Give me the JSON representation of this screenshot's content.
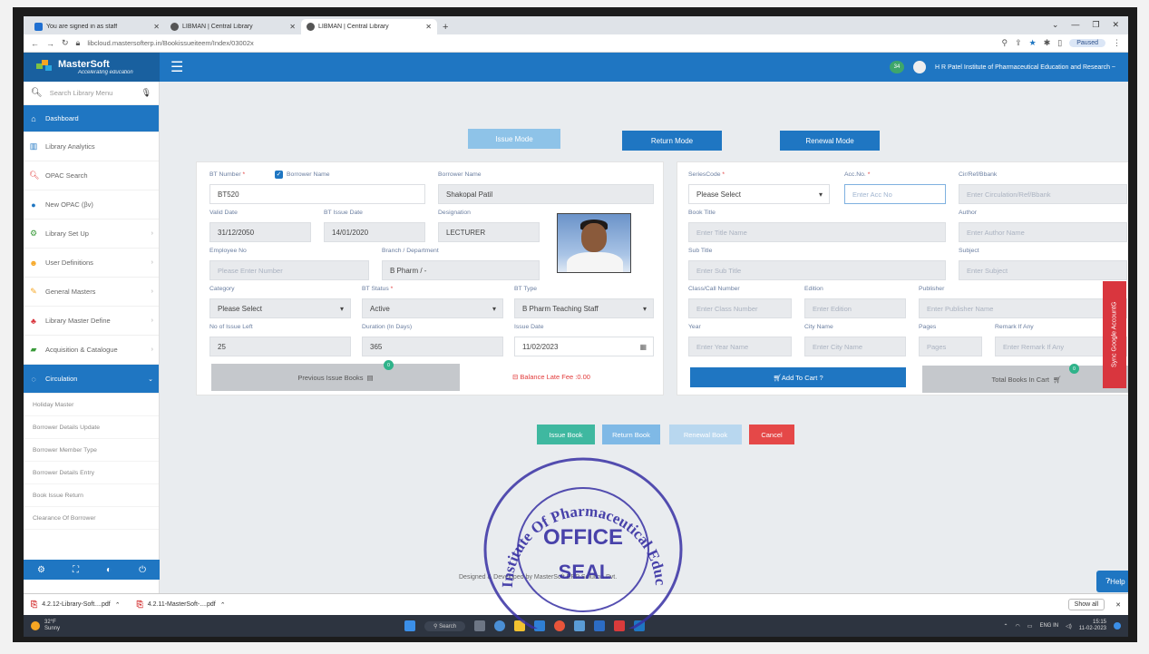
{
  "browser": {
    "tabs": [
      {
        "title": "You are signed in as staff"
      },
      {
        "title": "LIBMAN | Central Library"
      },
      {
        "title": "LIBMAN | Central Library"
      }
    ],
    "new_tab": "+",
    "url": "libcloud.mastersofterp.in/Bookissueiteem/Index/03002x",
    "profile": "Paused"
  },
  "header": {
    "logo": "MasterSoft",
    "tagline": "Accelerating education",
    "menu_icon": "hamburger-icon",
    "notif_count": "34",
    "institute": "H R Patel Institute of Pharmaceutical Education and Research ~"
  },
  "sidebar": {
    "search_placeholder": "Search Library Menu",
    "items": [
      {
        "label": "Dashboard",
        "icon": "home-icon"
      },
      {
        "label": "Library Analytics",
        "icon": "chart-icon"
      },
      {
        "label": "OPAC Search",
        "icon": "search-icon"
      },
      {
        "label": "New OPAC (βv)",
        "icon": "globe-icon"
      },
      {
        "label": "Library Set Up",
        "icon": "gears-icon"
      },
      {
        "label": "User Definitions",
        "icon": "users-icon"
      },
      {
        "label": "General Masters",
        "icon": "edit-icon"
      },
      {
        "label": "Library Master Define",
        "icon": "sitemap-icon"
      },
      {
        "label": "Acquisition & Catalogue",
        "icon": "book-icon"
      },
      {
        "label": "Circulation",
        "icon": "circle-icon"
      }
    ],
    "subitems": [
      "Holiday Master",
      "Borrower Details Update",
      "Borrower Member Type",
      "Borrower Details Entry",
      "Book Issue Return",
      "Clearance Of Borrower"
    ]
  },
  "modes": {
    "issue": "Issue Mode",
    "return": "Return Mode",
    "renewal": "Renewal Mode"
  },
  "borrower": {
    "bt_number_label": "BT Number",
    "borrower_name_check": "Borrower Name",
    "bt_number": "BT520",
    "borrower_name_label": "Borrower Name",
    "borrower_name": "Shakopal  Patil",
    "valid_date_label": "Valid Date",
    "valid_date": "31/12/2050",
    "bt_issue_date_label": "BT Issue Date",
    "bt_issue_date": "14/01/2020",
    "designation_label": "Designation",
    "designation": "LECTURER",
    "employee_no_label": "Employee No",
    "employee_no_placeholder": "Please Enter Number",
    "branch_label": "Branch / Department",
    "branch": "B Pharm / -",
    "category_label": "Category",
    "category": "Please Select",
    "bt_status_label": "BT Status",
    "bt_status": "Active",
    "bt_type_label": "BT Type",
    "bt_type": "B Pharm Teaching Staff",
    "issue_left_label": "No of Issue Left",
    "issue_left": "25",
    "duration_label": "Duration (In Days)",
    "duration": "365",
    "issue_date_label": "Issue Date",
    "issue_date": "11/02/2023",
    "previous_issue_books": "Previous Issue Books",
    "previous_badge": "0",
    "late_fee": "Balance Late Fee :0.00"
  },
  "book": {
    "series_label": "SeriesCode",
    "series": "Please Select",
    "acc_label": "Acc.No.",
    "acc_placeholder": "Enter Acc No",
    "cir_label": "Cir/Ref/Bbank",
    "cir_placeholder": "Enter Circulation/Ref/Bbank",
    "title_label": "Book Title",
    "title_placeholder": "Enter Title Name",
    "author_label": "Author",
    "author_placeholder": "Enter Author Name",
    "subtitle_label": "Sub Title",
    "subtitle_placeholder": "Enter Sub Title",
    "subject_label": "Subject",
    "subject_placeholder": "Enter Subject",
    "class_label": "Class/Call Number",
    "class_placeholder": "Enter Class Number",
    "edition_label": "Edition",
    "edition_placeholder": "Enter Edition",
    "publisher_label": "Publisher",
    "publisher_placeholder": "Enter Publisher Name",
    "year_label": "Year",
    "year_placeholder": "Enter Year Name",
    "city_label": "City Name",
    "city_placeholder": "Enter City Name",
    "pages_label": "Pages",
    "pages_placeholder": "Pages",
    "remark_label": "Remark If Any",
    "remark_placeholder": "Enter Remark If Any",
    "add_to_cart": "Add To Cart ?",
    "total_books": "Total Books In Cart",
    "cart_badge": "0"
  },
  "actions": {
    "issue": "Issue Book",
    "return": "Return Book",
    "renewal": "Renewal Book",
    "cancel": "Cancel"
  },
  "footer": {
    "text": "Designed & Developed by MasterSoft ERP Solution Pvt.",
    "help": "Help",
    "sync": "Sync Google Account"
  },
  "downloads": [
    "4.2.12-Library-Soft....pdf",
    "4.2.11-MasterSoft-....pdf"
  ],
  "downloads_show_all": "Show all",
  "taskbar": {
    "weather_temp": "32°F",
    "weather_text": "Sunny",
    "search": "Search",
    "lang": "ENG IN",
    "time": "15:15",
    "date": "11-02-2023"
  },
  "seal": {
    "ring_text": "Institute Of Pharmaceutical Education & Research",
    "line1": "OFFICE",
    "line2": "SEAL"
  },
  "colors": {
    "primary": "#1f76c2",
    "issue_mode": "#8ec3e8",
    "issue_btn": "#3fb8a0",
    "return_btn": "#7fb9e6",
    "renewal_btn": "#b8d7ef",
    "cancel_btn": "#e54848",
    "stamp": "#3730a3"
  }
}
